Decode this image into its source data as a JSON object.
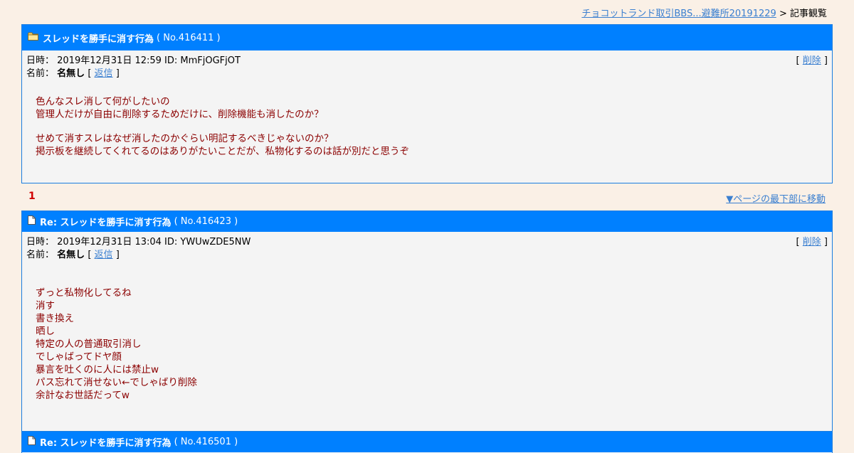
{
  "breadcrumb": {
    "link": "チョコットランド取引BBS...避難所20191229",
    "separator": ">",
    "current": "記事観覧"
  },
  "labels": {
    "date": "日時：",
    "name": "名前：",
    "delete": "削除",
    "reply": "返信",
    "open": "[",
    "close": "]"
  },
  "posts": [
    {
      "title": "スレッドを勝手に消す行為",
      "no": "( No.416411 )",
      "datetime": "2019年12月31日 12:59 ID: MmFjOGFjOT",
      "author": "名無し",
      "lines": [
        "色んなスレ消して何がしたいの",
        "管理人だけが自由に削除するためだけに、削除機能も消したのか？",
        "",
        "せめて消すスレはなぜ消したのかぐらい明記するべきじゃないのか？",
        "掲示板を継続してくれてるのはありがたいことだが、私物化するのは話が別だと思うぞ"
      ]
    },
    {
      "title": "Re: スレッドを勝手に消す行為",
      "no": "( No.416423 )",
      "datetime": "2019年12月31日 13:04 ID: YWUwZDE5NW",
      "author": "名無し",
      "lines": [
        "ずっと私物化してるね",
        "消す",
        "書き換え",
        "晒し",
        "特定の人の普通取引消し",
        "でしゃばってドヤ顔",
        "暴言を吐くのに人には禁止w",
        "パス忘れて消せない←でしゃばり削除",
        "余計なお世話だってw"
      ]
    },
    {
      "title": "Re: スレッドを勝手に消す行為",
      "no": "( No.416501 )"
    }
  ],
  "counter": "1",
  "jump_link": "▼ページの最下部に移動",
  "icons": {
    "thread": "folder-icon",
    "reply": "document-icon"
  }
}
